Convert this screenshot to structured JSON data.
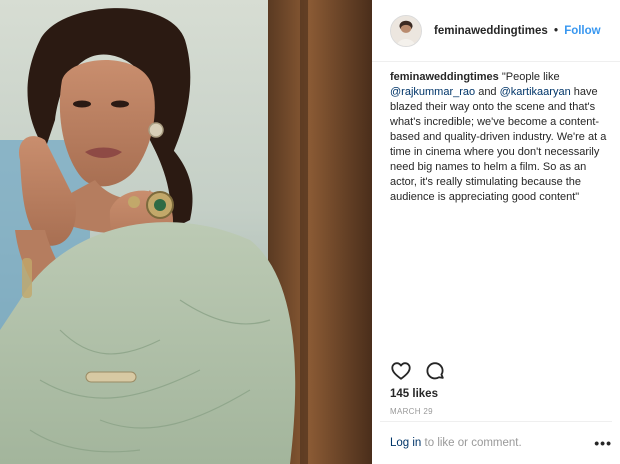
{
  "post": {
    "username": "feminaweddingtimes",
    "separator": "•",
    "follow_label": "Follow",
    "caption": {
      "user": "feminaweddingtimes",
      "text_1": " \"People like ",
      "mention_1": "@rajkummar_rao",
      "text_2": " and ",
      "mention_2": "@kartikaaryan",
      "text_3": " have blazed their way onto the scene and that's what's incredible; we've become a content-based and quality-driven industry. We're at a time in cinema where you don't necessarily need big names to helm a film. So as an actor, it's really stimulating because the audience is appreciating good content\""
    },
    "likes": "145 likes",
    "date": "MARCH 29",
    "footer": {
      "login_link": "Log in",
      "login_rest": " to like or comment.",
      "more": "•••"
    }
  },
  "icons": {
    "like": "heart-icon",
    "comment": "comment-icon",
    "more": "more-options-icon"
  },
  "colors": {
    "link": "#3897f0",
    "mention": "#003569",
    "muted": "#999999",
    "text": "#262626"
  }
}
